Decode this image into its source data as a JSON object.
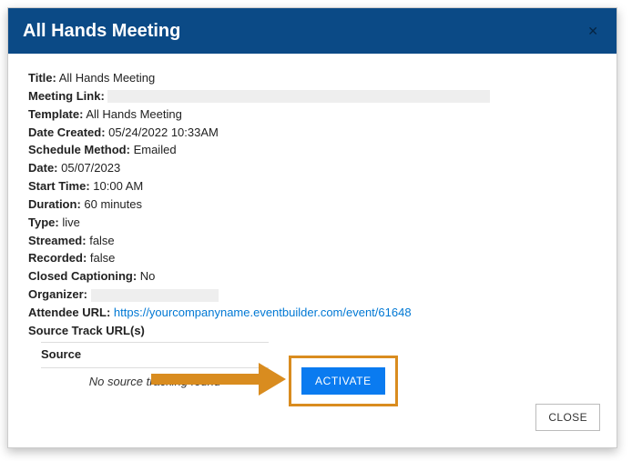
{
  "header": {
    "title": "All Hands Meeting"
  },
  "fields": {
    "title_label": "Title:",
    "title_value": "All Hands Meeting",
    "meeting_link_label": "Meeting Link:",
    "template_label": "Template:",
    "template_value": "All Hands Meeting",
    "date_created_label": "Date Created:",
    "date_created_value": "05/24/2022 10:33AM",
    "schedule_method_label": "Schedule Method:",
    "schedule_method_value": "Emailed",
    "date_label": "Date:",
    "date_value": "05/07/2023",
    "start_time_label": "Start Time:",
    "start_time_value": "10:00 AM",
    "duration_label": "Duration:",
    "duration_value": "60 minutes",
    "type_label": "Type:",
    "type_value": "live",
    "streamed_label": "Streamed:",
    "streamed_value": "false",
    "recorded_label": "Recorded:",
    "recorded_value": "false",
    "closed_captioning_label": "Closed Captioning:",
    "closed_captioning_value": "No",
    "organizer_label": "Organizer:",
    "attendee_url_label": "Attendee URL:",
    "attendee_url_value": "https://yourcompanyname.eventbuilder.com/event/61648",
    "source_track_label": "Source Track URL(s)"
  },
  "source": {
    "header": "Source",
    "empty_text": "No source tracking found"
  },
  "buttons": {
    "activate": "ACTIVATE",
    "close": "CLOSE"
  },
  "colors": {
    "header_bg": "#0b4a86",
    "accent_blue": "#0a7bf0",
    "highlight_orange": "#d98c1f",
    "link": "#0078d4"
  }
}
